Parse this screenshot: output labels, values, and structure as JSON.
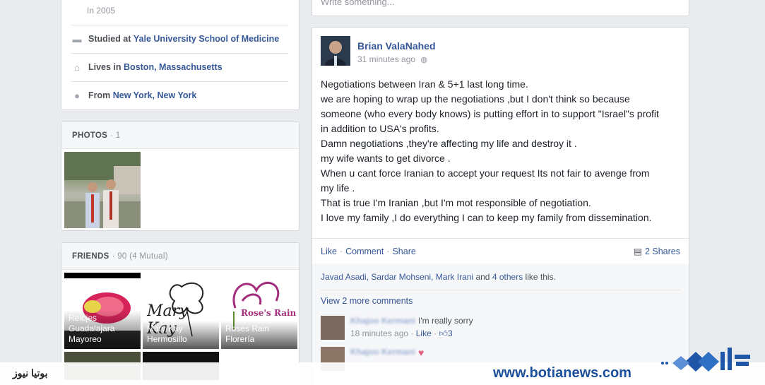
{
  "about": {
    "worked_sub": "In 2005",
    "studied_prefix": "Studied at",
    "studied_school": "Yale University School of Medicine",
    "lives_prefix": "Lives in",
    "lives_city": "Boston, Massachusetts",
    "from_prefix": "From",
    "from_city": "New York, New York"
  },
  "photos": {
    "title": "PHOTOS",
    "count": "· 1"
  },
  "friends": {
    "title": "FRIENDS",
    "count": "· 90 (4 Mutual)",
    "items": [
      {
        "name": "Relojes Guadalajara Mayoreo"
      },
      {
        "name": "Mary Kay Hermosillo"
      },
      {
        "name": "Roses Rain Florería"
      }
    ],
    "logo_text_rose": "Rose's Rain",
    "logo_text_mary": "Mary Kay"
  },
  "composer": {
    "placeholder": "Write something..."
  },
  "post": {
    "author": "Brian ValaNahed",
    "time": "31 minutes ago",
    "lines": [
      "Negotiations between Iran & 5+1 last long time.",
      "we are hoping to wrap up the negotiations ,but I don't think so because",
      "someone (who every body knows) is putting effort in to support \"Israel\"s profit",
      "in addition to USA's profits.",
      "Damn negotiations ,they're affecting my life and destroy it .",
      "my wife wants to get divorce .",
      "When u cant force Iranian to accept your request Its not fair to avenge from",
      "my life .",
      "That is true I'm Iranian ,but I'm mot responsible of negotiation.",
      "I love my family ,I do everything I can to keep my family from dissemination."
    ],
    "like": "Like",
    "comment": "Comment",
    "share": "Share",
    "shares": "2 Shares",
    "likers": "Javad Asadi, Sardar Mohseni, Mark Irani",
    "likers_rest": "and",
    "others": "4 others",
    "likes_tail": "like this.",
    "more_comments": "View 2 more comments",
    "comments": [
      {
        "author": "Khajoo Kermani",
        "text": "I'm really sorry",
        "time": "18 minutes ago",
        "like": "Like",
        "likes": "3"
      },
      {
        "author": "Khajoo Kermani",
        "text": "♥"
      }
    ]
  },
  "watermark": {
    "persian": "بوتیا نیوز",
    "url": "www.botianews.com"
  }
}
